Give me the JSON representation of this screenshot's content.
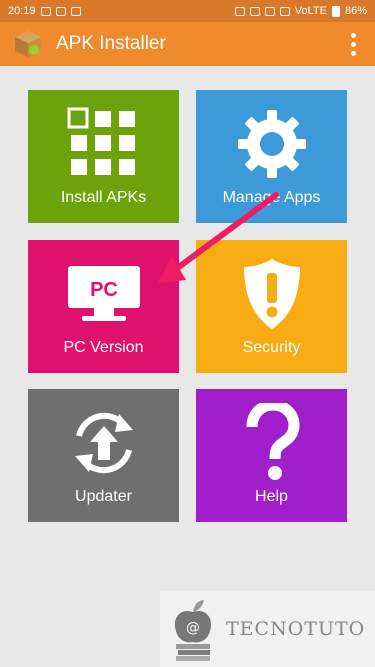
{
  "status_bar": {
    "time": "20:19",
    "network": "VoLTE",
    "battery": "86%"
  },
  "app_bar": {
    "title": "APK Installer",
    "menu_icon": "overflow-menu-icon"
  },
  "tiles": [
    {
      "label": "Install APKs",
      "icon": "grid-icon",
      "color": "#6ea20a"
    },
    {
      "label": "Manage Apps",
      "icon": "gear-icon",
      "color": "#3d9ad8"
    },
    {
      "label": "PC Version",
      "icon": "monitor-pc-icon",
      "icon_text": "PC",
      "color": "#e0116d"
    },
    {
      "label": "Security",
      "icon": "shield-alert-icon",
      "color": "#f7ac14"
    },
    {
      "label": "Updater",
      "icon": "refresh-upload-icon",
      "color": "#6f6f6f"
    },
    {
      "label": "Help",
      "icon": "question-mark-icon",
      "color": "#a01fca"
    }
  ],
  "watermark": {
    "text": "TECNOTUTO"
  },
  "colors": {
    "status_bar": "#d9782a",
    "app_bar": "#ef8b2c",
    "background": "#e8e8e8",
    "annotation_arrow": "#ee1d63"
  }
}
